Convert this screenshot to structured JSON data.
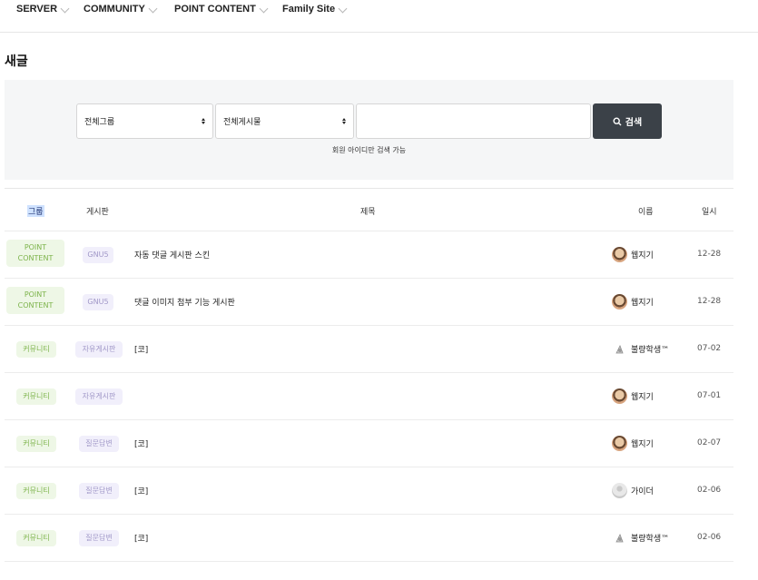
{
  "nav": {
    "items": [
      {
        "label": "SERVER"
      },
      {
        "label": "COMMUNITY"
      },
      {
        "label": "POINT CONTENT"
      },
      {
        "label": "Family Site"
      }
    ]
  },
  "page": {
    "title": "새글"
  },
  "search": {
    "group_select": "전체그룹",
    "board_select": "전체게시물",
    "input_value": "",
    "button_label": "검색",
    "hint": "회원 아이디만 검색 가능"
  },
  "table": {
    "headers": {
      "group": "그룹",
      "board": "게시판",
      "subject": "제목",
      "name": "이름",
      "date": "일시"
    },
    "rows": [
      {
        "group": "POINT CONTENT",
        "board": "GNU5",
        "subject": "자동 댓글 게시판 스킨",
        "name": "웹지기",
        "avatar": "photo",
        "date": "12-28"
      },
      {
        "group": "POINT CONTENT",
        "board": "GNU5",
        "subject": "댓글 이미지 첨부 기능 게시판",
        "name": "웹지기",
        "avatar": "photo",
        "date": "12-28"
      },
      {
        "group": "커뮤니티",
        "board": "자유게시판",
        "subject": "[코]",
        "name": "불량학생™",
        "avatar": "level-icon",
        "date": "07-02"
      },
      {
        "group": "커뮤니티",
        "board": "자유게시판",
        "subject": "",
        "name": "웹지기",
        "avatar": "photo",
        "date": "07-01"
      },
      {
        "group": "커뮤니티",
        "board": "질문답변",
        "subject": "[코]",
        "name": "웹지기",
        "avatar": "photo",
        "date": "02-07"
      },
      {
        "group": "커뮤니티",
        "board": "질문답변",
        "subject": "[코]",
        "name": "가이더",
        "avatar": "default",
        "date": "02-06"
      },
      {
        "group": "커뮤니티",
        "board": "질문답변",
        "subject": "[코]",
        "name": "불량학생™",
        "avatar": "level-icon",
        "date": "02-06"
      }
    ]
  },
  "colors": {
    "accent_green": "#7cb34a",
    "accent_purple": "#a198c8",
    "button_dark": "#3b4148"
  }
}
